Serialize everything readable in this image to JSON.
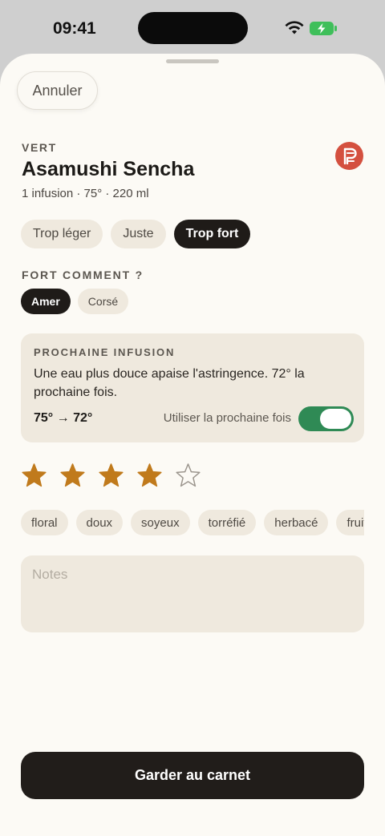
{
  "status_bar": {
    "time": "09:41"
  },
  "header": {
    "cancel_label": "Annuler"
  },
  "tea": {
    "category": "VERT",
    "name": "Asamushi Sencha",
    "details": "1 infusion · 75° · 220 ml",
    "brand_logo": "brand-logo"
  },
  "strength": {
    "options": [
      "Trop léger",
      "Juste",
      "Trop fort"
    ],
    "selected": "Trop fort"
  },
  "how_strong": {
    "label": "FORT COMMENT ?",
    "options": [
      "Amer",
      "Corsé"
    ],
    "selected": "Amer"
  },
  "next_infusion": {
    "label": "PROCHAINE INFUSION",
    "advice": "Une eau plus douce apaise l'astringence. 72° la prochaine fois.",
    "temp_change": "75° → 72°",
    "use_label": "Utiliser la prochaine fois",
    "use_enabled": true
  },
  "rating": {
    "value": 4,
    "max": 5
  },
  "tags": [
    "floral",
    "doux",
    "soyeux",
    "torréfié",
    "herbacé",
    "fruité"
  ],
  "notes": {
    "placeholder": "Notes",
    "value": ""
  },
  "save_label": "Garder au carnet",
  "colors": {
    "background": "#fcfaf5",
    "chip": "#efe9de",
    "dark": "#1f1b18",
    "accent_star": "#c07a1c",
    "toggle_on": "#2f8a55",
    "brand_red": "#d4503f"
  }
}
